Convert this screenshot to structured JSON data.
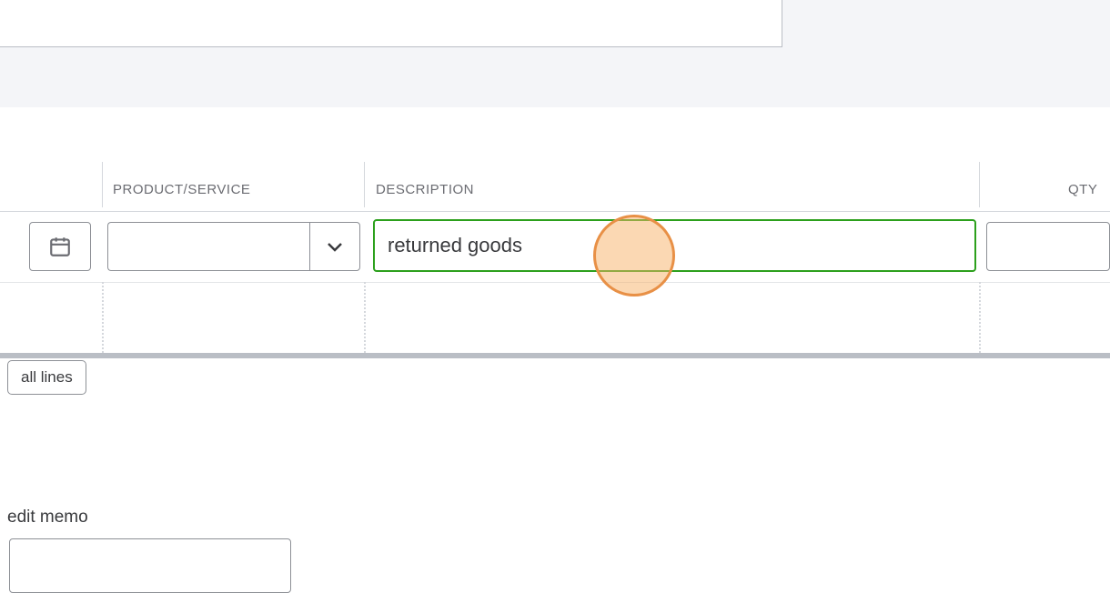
{
  "table": {
    "headers": {
      "product_service": "PRODUCT/SERVICE",
      "description": "DESCRIPTION",
      "qty": "QTY"
    },
    "row": {
      "product_service": "",
      "description": "returned goods",
      "qty": ""
    }
  },
  "buttons": {
    "all_lines": "all lines"
  },
  "labels": {
    "edit_memo": "edit memo"
  },
  "memo": ""
}
